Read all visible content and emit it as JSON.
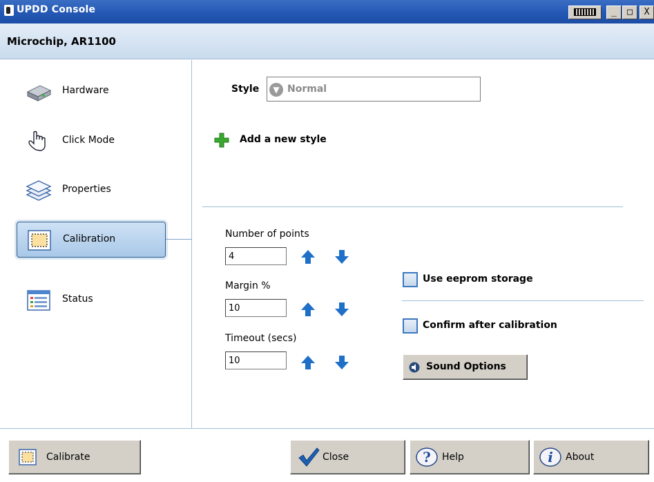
{
  "window": {
    "title": "UPDD Console"
  },
  "header": {
    "device": "Microchip, AR1100"
  },
  "sidebar": {
    "items": [
      {
        "label": "Hardware",
        "icon": "hardware-icon"
      },
      {
        "label": "Click Mode",
        "icon": "hand-pointer-icon"
      },
      {
        "label": "Properties",
        "icon": "layers-icon"
      },
      {
        "label": "Calibration",
        "icon": "calibration-icon",
        "selected": true
      },
      {
        "label": "Status",
        "icon": "status-list-icon"
      }
    ]
  },
  "style": {
    "label": "Style",
    "value": "Normal",
    "add_label": "Add a new style"
  },
  "fields": {
    "points": {
      "label": "Number of points",
      "value": "4"
    },
    "margin": {
      "label": "Margin %",
      "value": "10"
    },
    "timeout": {
      "label": "Timeout (secs)",
      "value": "10"
    }
  },
  "options": {
    "eeprom": {
      "label": "Use eeprom storage",
      "checked": false
    },
    "confirm": {
      "label": "Confirm after calibration",
      "checked": false
    },
    "sound": {
      "label": "Sound Options"
    }
  },
  "footer": {
    "calibrate": "Calibrate",
    "close": "Close",
    "help": "Help",
    "about": "About"
  },
  "colors": {
    "titlebar": "#2458b4",
    "accent": "#1f6fc8",
    "header": "#c9dbee",
    "plus": "#3aa830"
  }
}
